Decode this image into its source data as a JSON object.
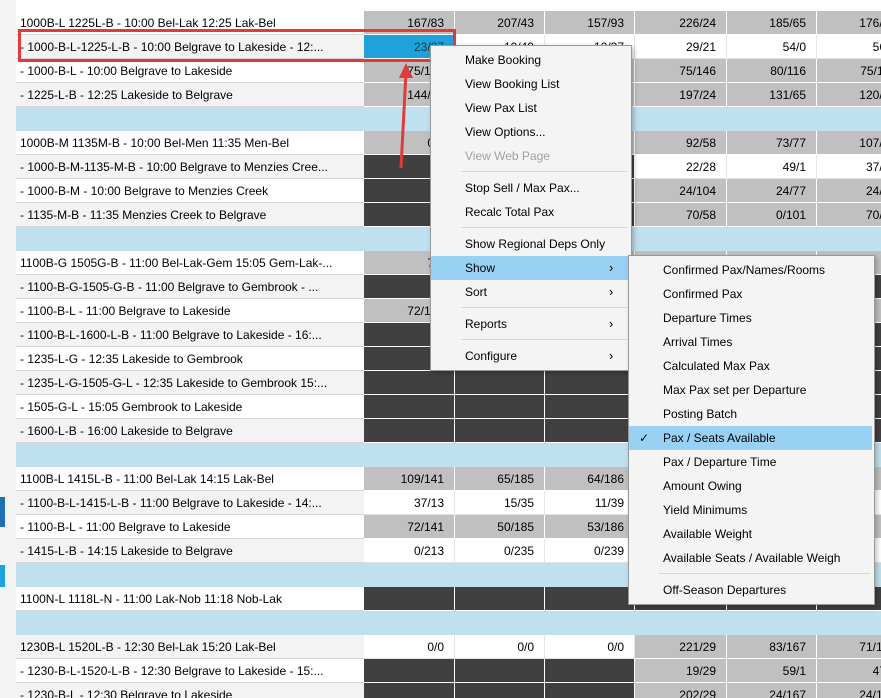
{
  "rows": [
    {
      "name": "1000B-L 1225L-B - 10:00 Bel-Lak 12:25 Lak-Bel",
      "cells": [
        [
          "g",
          "167/83"
        ],
        [
          "g",
          "207/43"
        ],
        [
          "g",
          "157/93"
        ],
        [
          "g",
          "226/24"
        ],
        [
          "g",
          "185/65"
        ],
        [
          "g",
          "176/74"
        ]
      ]
    },
    {
      "name": " - 1000-B-L-1225-L-B - 10:00 Belgrave to Lakeside - 12:...",
      "cells": [
        [
          "b",
          "23/27"
        ],
        [
          "w",
          "19/49"
        ],
        [
          "w",
          "12/37"
        ],
        [
          "w",
          "29/21"
        ],
        [
          "w",
          "54/0"
        ],
        [
          "w",
          "56/1"
        ]
      ]
    },
    {
      "name": " - 1000-B-L - 10:00 Belgrave to Lakeside",
      "cells": [
        [
          "g",
          "75/152"
        ],
        [
          "g",
          ""
        ],
        [
          "g",
          ""
        ],
        [
          "g",
          "75/146"
        ],
        [
          "g",
          "80/116"
        ],
        [
          "g",
          "75/119"
        ]
      ]
    },
    {
      "name": " - 1225-L-B - 12:25 Lakeside to Belgrave",
      "cells": [
        [
          "g",
          "144/83"
        ],
        [
          "g",
          ""
        ],
        [
          "g",
          ""
        ],
        [
          "g",
          "197/24"
        ],
        [
          "g",
          "131/65"
        ],
        [
          "g",
          "120/74"
        ]
      ]
    },
    {
      "spacer": true
    },
    {
      "name": "1000B-M 1135M-B - 10:00 Bel-Men 11:35 Men-Bel",
      "cells": [
        [
          "g",
          "0/0"
        ],
        [
          "g",
          ""
        ],
        [
          "g",
          ""
        ],
        [
          "g",
          "92/58"
        ],
        [
          "g",
          "73/77"
        ],
        [
          "g",
          "107/43"
        ]
      ]
    },
    {
      "name": " - 1000-B-M-1135-M-B - 10:00 Belgrave to Menzies Cree...",
      "cells": [
        [
          "d",
          ""
        ],
        [
          "d",
          ""
        ],
        [
          "d",
          ""
        ],
        [
          "w",
          "22/28"
        ],
        [
          "w",
          "49/1"
        ],
        [
          "w",
          "37/13"
        ]
      ]
    },
    {
      "name": " - 1000-B-M - 10:00 Belgrave to Menzies Creek",
      "cells": [
        [
          "d",
          ""
        ],
        [
          "d",
          ""
        ],
        [
          "d",
          ""
        ],
        [
          "g",
          "24/104"
        ],
        [
          "g",
          "24/77"
        ],
        [
          "g",
          "24/89"
        ]
      ]
    },
    {
      "name": " - 1135-M-B - 11:35 Menzies Creek to Belgrave",
      "cells": [
        [
          "d",
          ""
        ],
        [
          "d",
          ""
        ],
        [
          "d",
          ""
        ],
        [
          "g",
          "70/58"
        ],
        [
          "g",
          "0/101"
        ],
        [
          "g",
          "70/43"
        ]
      ]
    },
    {
      "spacer": true
    },
    {
      "name": "1100B-G 1505G-B - 11:00 Bel-Lak-Gem 15:05 Gem-Lak-...",
      "cells": [
        [
          "g",
          "72/"
        ],
        [
          "g",
          ""
        ],
        [
          "g",
          ""
        ],
        [
          "g",
          ""
        ],
        [
          "g",
          ""
        ],
        [
          "g",
          "6"
        ]
      ]
    },
    {
      "name": " - 1100-B-G-1505-G-B - 11:00 Belgrave to Gembrook - ...",
      "cells": [
        [
          "d",
          ""
        ],
        [
          "d",
          ""
        ],
        [
          "d",
          ""
        ],
        [
          "d",
          ""
        ],
        [
          "d",
          ""
        ],
        [
          "d",
          ""
        ]
      ]
    },
    {
      "name": " - 1100-B-L - 11:00 Belgrave to Lakeside",
      "cells": [
        [
          "g",
          "72/141"
        ],
        [
          "g",
          ""
        ],
        [
          "g",
          ""
        ],
        [
          "g",
          ""
        ],
        [
          "g",
          ""
        ],
        [
          "g",
          "5"
        ]
      ]
    },
    {
      "name": " - 1100-B-L-1600-L-B - 11:00 Belgrave to Lakeside - 16:...",
      "cells": [
        [
          "d",
          ""
        ],
        [
          "d",
          ""
        ],
        [
          "d",
          ""
        ],
        [
          "d",
          ""
        ],
        [
          "d",
          ""
        ],
        [
          "d",
          ""
        ]
      ]
    },
    {
      "name": " - 1235-L-G - 12:35 Lakeside to Gembrook",
      "cells": [
        [
          "d",
          ""
        ],
        [
          "d",
          ""
        ],
        [
          "d",
          ""
        ],
        [
          "d",
          ""
        ],
        [
          "d",
          ""
        ],
        [
          "d",
          "0"
        ]
      ]
    },
    {
      "name": " - 1235-L-G-1505-G-L - 12:35 Lakeside to Gembrook 15:...",
      "cells": [
        [
          "d",
          ""
        ],
        [
          "d",
          ""
        ],
        [
          "d",
          ""
        ],
        [
          "d",
          ""
        ],
        [
          "d",
          ""
        ],
        [
          "d",
          ""
        ]
      ]
    },
    {
      "name": " - 1505-G-L - 15:05 Gembrook to Lakeside",
      "cells": [
        [
          "d",
          ""
        ],
        [
          "d",
          ""
        ],
        [
          "d",
          ""
        ],
        [
          "d",
          ""
        ],
        [
          "d",
          ""
        ],
        [
          "d",
          "0"
        ]
      ]
    },
    {
      "name": " - 1600-L-B - 16:00 Lakeside to Belgrave",
      "cells": [
        [
          "d",
          ""
        ],
        [
          "d",
          ""
        ],
        [
          "d",
          ""
        ],
        [
          "d",
          ""
        ],
        [
          "d",
          ""
        ],
        [
          "d",
          "0"
        ]
      ]
    },
    {
      "spacer": true
    },
    {
      "name": "1100B-L 1415L-B - 11:00 Bel-Lak 14:15 Lak-Bel",
      "cells": [
        [
          "g",
          "109/141"
        ],
        [
          "g",
          "65/185"
        ],
        [
          "g",
          "64/186"
        ],
        [
          "g",
          ""
        ],
        [
          "g",
          ""
        ],
        [
          "g",
          "0"
        ]
      ]
    },
    {
      "name": " - 1100-B-L-1415-L-B - 11:00 Belgrave to Lakeside - 14:...",
      "cells": [
        [
          "w",
          "37/13"
        ],
        [
          "w",
          "15/35"
        ],
        [
          "w",
          "11/39"
        ],
        [
          "w",
          ""
        ],
        [
          "w",
          ""
        ],
        [
          "w",
          "0"
        ]
      ]
    },
    {
      "name": " - 1100-B-L - 11:00 Belgrave to Lakeside",
      "cells": [
        [
          "g",
          "72/141"
        ],
        [
          "g",
          "50/185"
        ],
        [
          "g",
          "53/186"
        ],
        [
          "g",
          ""
        ],
        [
          "g",
          ""
        ],
        [
          "g",
          "0"
        ]
      ]
    },
    {
      "name": " - 1415-L-B - 14:15 Lakeside to Belgrave",
      "cells": [
        [
          "w",
          "0/213"
        ],
        [
          "w",
          "0/235"
        ],
        [
          "w",
          "0/239"
        ],
        [
          "w",
          ""
        ],
        [
          "w",
          ""
        ],
        [
          "w",
          "0"
        ]
      ]
    },
    {
      "spacer": true
    },
    {
      "name": "1100N-L 1118L-N - 11:00 Lak-Nob 11:18 Nob-Lak",
      "cells": [
        [
          "d",
          ""
        ],
        [
          "d",
          ""
        ],
        [
          "d",
          ""
        ],
        [
          "d",
          ""
        ],
        [
          "d",
          ""
        ],
        [
          "d",
          ""
        ]
      ]
    },
    {
      "spacer": true
    },
    {
      "name": "1230B-L 1520L-B - 12:30 Bel-Lak 15:20 Lak-Bel",
      "cells": [
        [
          "w",
          "0/0"
        ],
        [
          "w",
          "0/0"
        ],
        [
          "w",
          "0/0"
        ],
        [
          "g",
          "221/29"
        ],
        [
          "g",
          "83/167"
        ],
        [
          "g",
          "71/179"
        ]
      ]
    },
    {
      "name": " - 1230-B-L-1520-L-B - 12:30 Belgrave to Lakeside - 15:...",
      "cells": [
        [
          "d",
          ""
        ],
        [
          "d",
          ""
        ],
        [
          "d",
          ""
        ],
        [
          "g",
          "19/29"
        ],
        [
          "g",
          "59/1"
        ],
        [
          "g",
          "47/3"
        ]
      ]
    },
    {
      "name": " - 1230-B-L - 12:30 Belgrave to Lakeside",
      "cells": [
        [
          "d",
          ""
        ],
        [
          "d",
          ""
        ],
        [
          "d",
          ""
        ],
        [
          "g",
          "202/29"
        ],
        [
          "g",
          "24/167"
        ],
        [
          "g",
          "24/179"
        ]
      ]
    }
  ],
  "context_menu": {
    "items": [
      {
        "label": "Make Booking"
      },
      {
        "label": "View Booking List"
      },
      {
        "label": "View Pax List"
      },
      {
        "label": "View Options..."
      },
      {
        "label": "View Web Page",
        "disabled": true
      },
      {
        "separator": true
      },
      {
        "label": "Stop Sell / Max Pax..."
      },
      {
        "label": "Recalc Total Pax"
      },
      {
        "separator": true
      },
      {
        "label": "Show Regional Deps Only"
      },
      {
        "label": "Show",
        "submenu": true,
        "highlighted": true
      },
      {
        "label": "Sort",
        "submenu": true
      },
      {
        "separator": true
      },
      {
        "label": "Reports",
        "submenu": true
      },
      {
        "separator": true
      },
      {
        "label": "Configure",
        "submenu": true
      }
    ]
  },
  "show_submenu": {
    "items": [
      {
        "label": "Confirmed Pax/Names/Rooms"
      },
      {
        "label": "Confirmed Pax"
      },
      {
        "label": "Departure Times"
      },
      {
        "label": "Arrival Times"
      },
      {
        "label": "Calculated Max Pax"
      },
      {
        "label": "Max Pax set per Departure"
      },
      {
        "label": "Posting Batch"
      },
      {
        "label": "Pax / Seats Available",
        "checked": true,
        "highlighted": true
      },
      {
        "label": "Pax / Departure Time"
      },
      {
        "label": "Amount Owing"
      },
      {
        "label": "Yield Minimums"
      },
      {
        "label": "Available Weight"
      },
      {
        "label": "Available Seats / Available Weigh"
      },
      {
        "separator": true
      },
      {
        "label": "Off-Season Departures"
      }
    ]
  },
  "icons": {
    "checkmark": "✓",
    "submenu_arrow": "›"
  },
  "colors": {
    "selected_cell": "#1fa2dc",
    "highlight_box": "#e03b3b",
    "menu_hover": "#99d1f5",
    "group_spacer": "#bfe1ef",
    "unavailable_cell": "#404040",
    "value_cell": "#c0c0c0"
  }
}
